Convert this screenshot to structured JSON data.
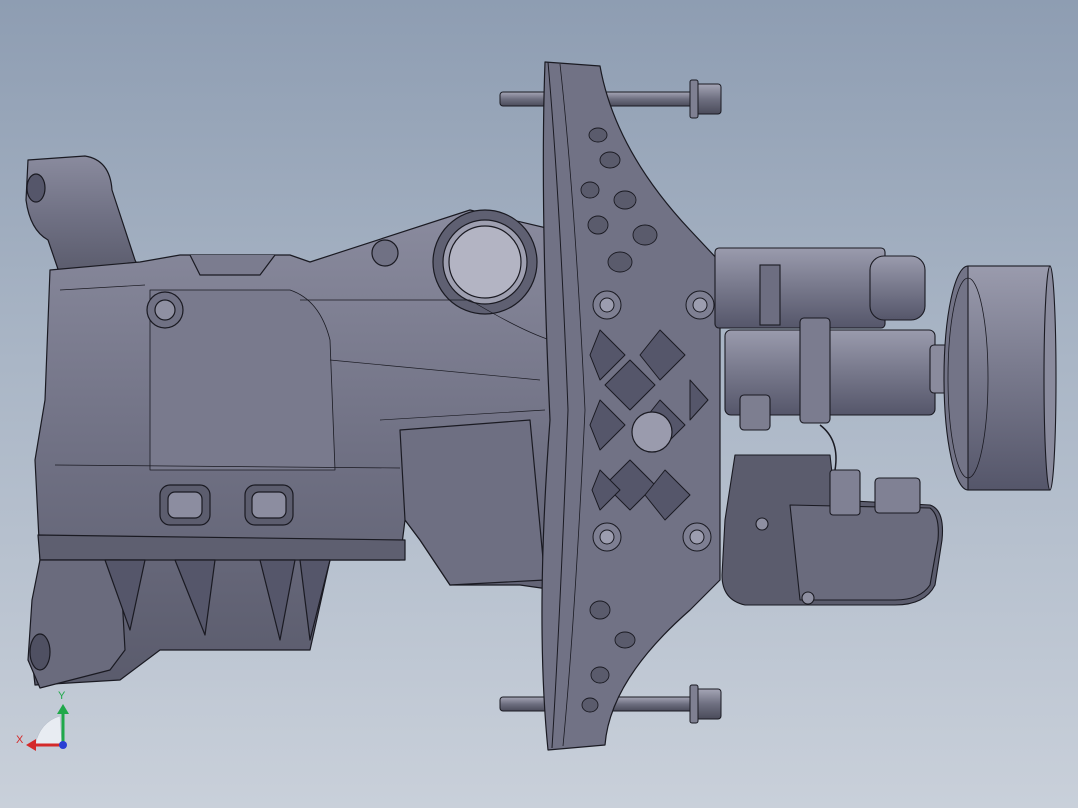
{
  "viewport": {
    "background_top": "#8e9db2",
    "background_bottom": "#c9d0da",
    "model_fill": "#6c6d7e",
    "model_fill_light": "#858699",
    "model_fill_dark": "#4b4c5c",
    "edge_color": "#1a1a22"
  },
  "triad": {
    "x_label": "X",
    "y_label": "Y",
    "x_color": "#d42a2a",
    "y_color": "#1fa84a",
    "z_color": "#2a3fd4"
  },
  "model": {
    "parts": [
      "housing",
      "mounting-flange",
      "bolts",
      "actuator-motor",
      "connector-block"
    ],
    "icon": "gearbox-assembly-icon"
  }
}
